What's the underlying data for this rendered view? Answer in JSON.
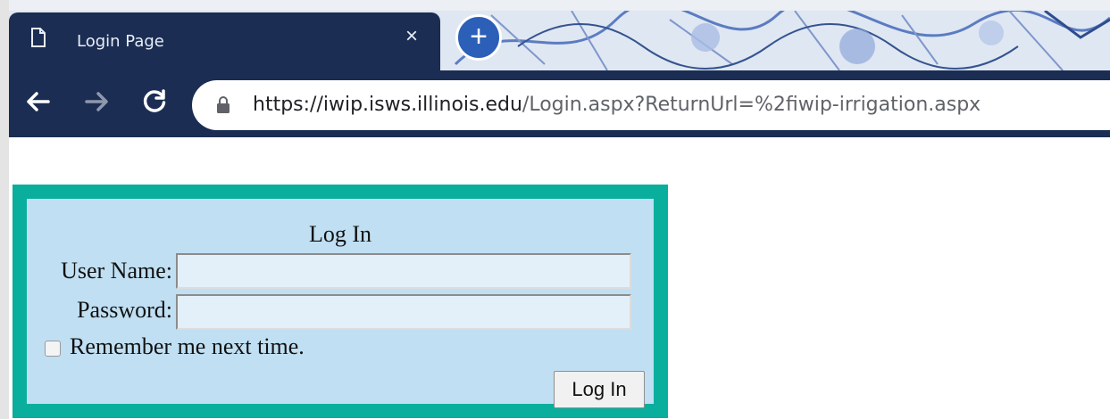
{
  "browser": {
    "tab": {
      "title": "Login Page",
      "close_glyph": "×"
    },
    "new_tab_glyph": "+",
    "address_bar": {
      "url_host": "https://iwip.isws.illinois.edu",
      "url_path": "/Login.aspx?ReturnUrl=%2fiwip-irrigation.aspx"
    },
    "colors": {
      "frame": "#1b2d53",
      "accent": "#2b5fb8"
    }
  },
  "login_form": {
    "title": "Log In",
    "username_label": "User Name:",
    "username_value": "",
    "password_label": "Password:",
    "password_value": "",
    "remember_label": "Remember me next time.",
    "remember_checked": false,
    "submit_label": "Log In",
    "colors": {
      "border": "#0aae9d",
      "background": "#c0dff2"
    }
  }
}
